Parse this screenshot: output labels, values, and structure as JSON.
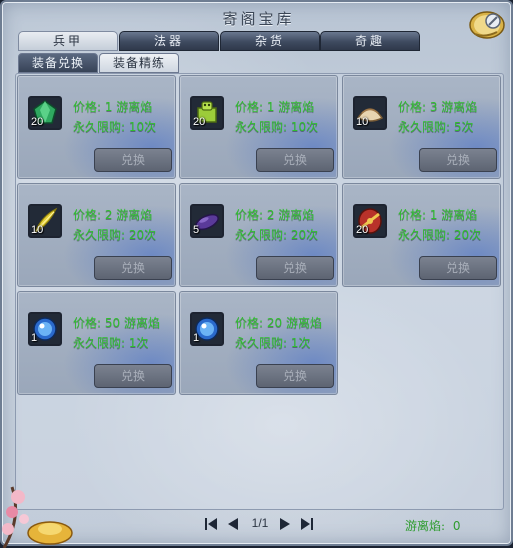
{
  "window": {
    "title": " 寄阁宝库"
  },
  "tabs": [
    {
      "label": "兵甲",
      "active": true
    },
    {
      "label": "法器",
      "active": false
    },
    {
      "label": "杂货",
      "active": false
    },
    {
      "label": "奇趣",
      "active": false
    }
  ],
  "subtabs": [
    {
      "label": "装备兑换",
      "active": true
    },
    {
      "label": "装备精练",
      "active": false
    }
  ],
  "items": [
    {
      "qty": "20",
      "price": "价格: 1 游离焰",
      "limit": "永久限购: 10次",
      "button": "兑换",
      "icon": "green-gem-icon"
    },
    {
      "qty": "20",
      "price": "价格: 1 游离焰",
      "limit": "永久限购: 10次",
      "button": "兑换",
      "icon": "jade-seal-icon"
    },
    {
      "qty": "10",
      "price": "价格: 3 游离焰",
      "limit": "永久限购: 5次",
      "button": "兑换",
      "icon": "dumpling-icon"
    },
    {
      "qty": "10",
      "price": "价格: 2 游离焰",
      "limit": "永久限购: 20次",
      "button": "兑换",
      "icon": "gold-feather-icon"
    },
    {
      "qty": "5",
      "price": "价格: 2 游离焰",
      "limit": "永久限购: 20次",
      "button": "兑换",
      "icon": "purple-pod-icon"
    },
    {
      "qty": "20",
      "price": "价格: 1 游离焰",
      "limit": "永久限购: 20次",
      "button": "兑换",
      "icon": "red-shield-icon"
    },
    {
      "qty": "1",
      "price": "价格: 50 游离焰",
      "limit": "永久限购: 1次",
      "button": "兑换",
      "icon": "blue-orb-icon"
    },
    {
      "qty": "1",
      "price": "价格: 20 游离焰",
      "limit": "永久限购: 1次",
      "button": "兑换",
      "icon": "blue-orb-icon"
    }
  ],
  "pager": {
    "text": "1/1"
  },
  "currency": {
    "label": "游离焰:",
    "value": "0"
  },
  "colors": {
    "price_text": "#2fbf2f",
    "accent": "#3e4a5f"
  }
}
